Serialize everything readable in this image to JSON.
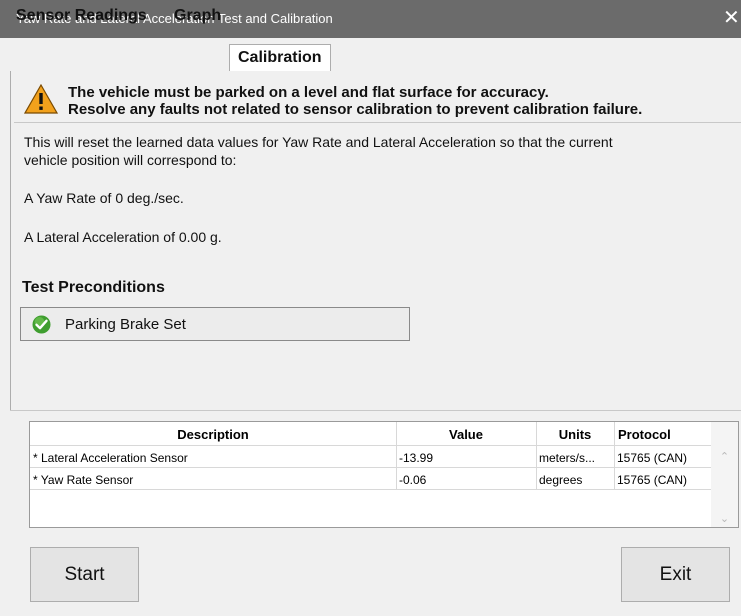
{
  "window": {
    "title": "Yaw Rate and Lateral Acceleration Test and Calibration",
    "close_glyph": "✕"
  },
  "tabs": [
    {
      "label": "Sensor Readings",
      "active": false
    },
    {
      "label": "Graph",
      "active": false
    },
    {
      "label": "Calibration",
      "active": true
    }
  ],
  "warning": {
    "icon": "warning-triangle-icon",
    "line1": "The vehicle must be parked on a level and flat surface for accuracy.",
    "line2": "Resolve any faults not related to sensor calibration to prevent calibration failure."
  },
  "description": {
    "line1": "This will reset the learned data values for Yaw Rate and Lateral Acceleration so  that the current",
    "line2": "vehicle position will correspond to:",
    "yaw": "A Yaw Rate of 0 deg./sec.",
    "lateral": "A Lateral Acceleration of 0.00 g."
  },
  "preconditions": {
    "title": "Test Preconditions",
    "items": [
      {
        "label": "Parking Brake Set",
        "status": "passed",
        "icon": "check-circle-icon"
      }
    ]
  },
  "grid": {
    "columns": [
      "Description",
      "Value",
      "Units",
      "Protocol"
    ],
    "rows": [
      {
        "description": "* Lateral Acceleration Sensor",
        "value": "-13.99",
        "units": "meters/s...",
        "protocol": "15765 (CAN)"
      },
      {
        "description": "* Yaw Rate Sensor",
        "value": "-0.06",
        "units": "degrees",
        "protocol": "15765 (CAN)"
      }
    ]
  },
  "buttons": {
    "start": "Start",
    "exit": "Exit"
  },
  "colors": {
    "titlebar": "#6b6b6b",
    "warning_fill": "#f2a11c",
    "check_fill": "#3f9e2f"
  }
}
